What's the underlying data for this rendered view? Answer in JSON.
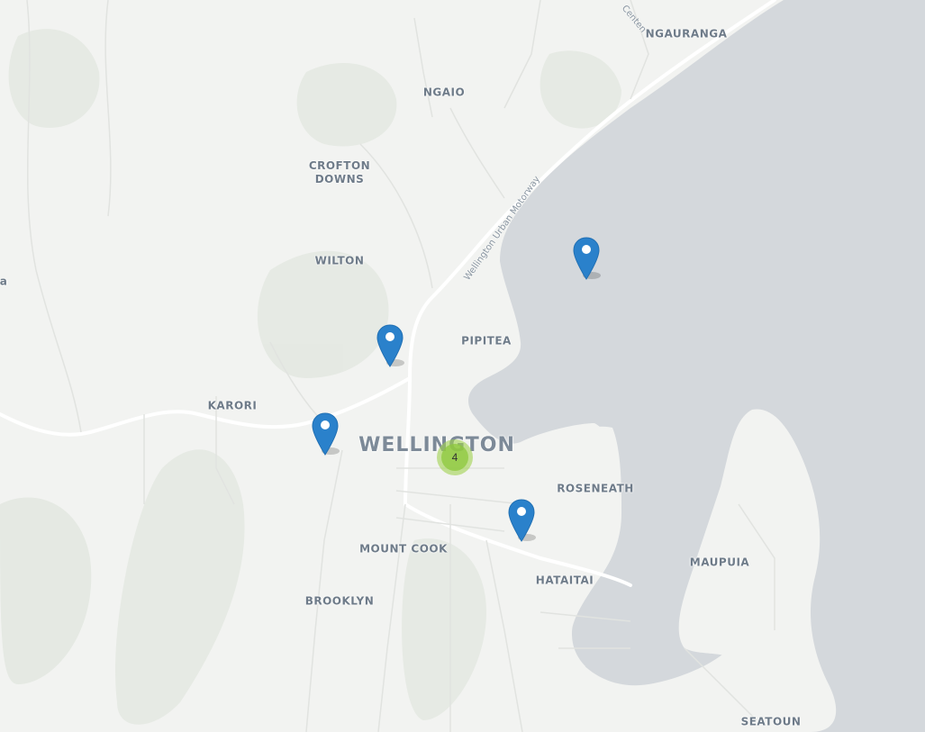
{
  "map": {
    "labels": {
      "ngauranga": "NGAURANGA",
      "ngaio": "NGAIO",
      "crofton_downs": "CROFTON\nDOWNS",
      "wilton": "WILTON",
      "pipitea": "PIPITEA",
      "karori": "KARORI",
      "wellington": "WELLINGTON",
      "roseneath": "ROSENEATH",
      "mount_cook": "MOUNT COOK",
      "hataitai": "HATAITAI",
      "maupuia": "MAUPUIA",
      "brooklyn": "BROOKLYN",
      "seatoun": "SEATOUN",
      "edge_left": "a"
    },
    "road_labels": {
      "motorway": "Wellington Urban Motorway",
      "centennial": "Centen"
    },
    "cluster": {
      "count": "4"
    },
    "colors": {
      "water": "#d4d8dc",
      "land": "#f2f3f1",
      "marker": "#2a81cb",
      "cluster": "#8cc83c"
    }
  }
}
